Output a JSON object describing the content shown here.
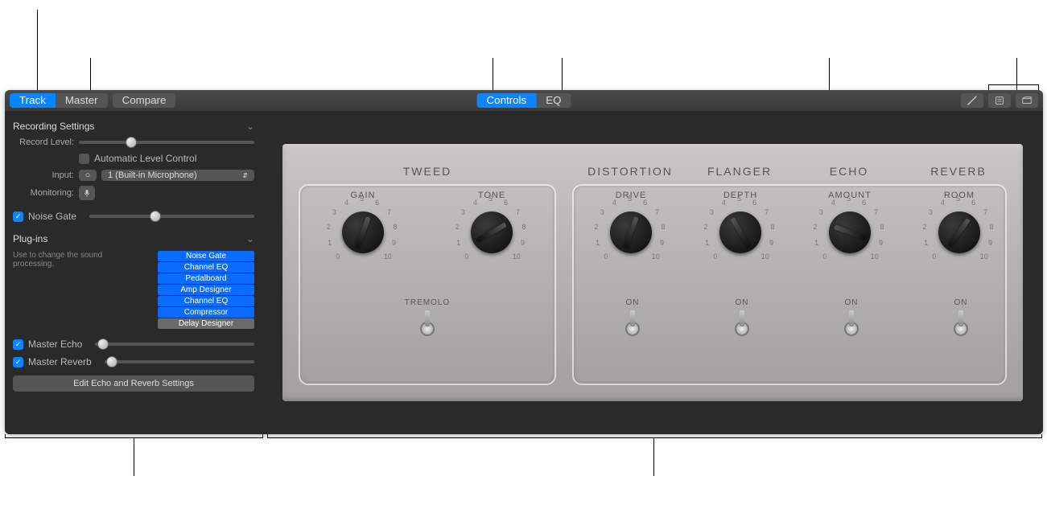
{
  "toolbar": {
    "track": "Track",
    "master": "Master",
    "compare": "Compare",
    "controls": "Controls",
    "eq": "EQ"
  },
  "sidebar": {
    "recording_settings": "Recording Settings",
    "record_level_label": "Record Level:",
    "auto_level": "Automatic Level Control",
    "input_label": "Input:",
    "input_symbol": "○",
    "input_value": "1  (Built-in Microphone)",
    "monitoring_label": "Monitoring:",
    "noise_gate": "Noise Gate",
    "plugins_header": "Plug-ins",
    "plugins_hint": "Use to change the sound processing.",
    "plugins": [
      {
        "label": "Noise Gate",
        "grey": false
      },
      {
        "label": "Channel EQ",
        "grey": false
      },
      {
        "label": "Pedalboard",
        "grey": false
      },
      {
        "label": "Amp Designer",
        "grey": false
      },
      {
        "label": "Channel EQ",
        "grey": false
      },
      {
        "label": "Compressor",
        "grey": false
      },
      {
        "label": "Delay Designer",
        "grey": true
      }
    ],
    "master_echo": "Master Echo",
    "master_reverb": "Master Reverb",
    "edit_btn": "Edit Echo and Reverb Settings"
  },
  "amp": {
    "tweed": "TWEED",
    "distortion": "DISTORTION",
    "flanger": "FLANGER",
    "echo": "ECHO",
    "reverb": "REVERB",
    "knobs": {
      "gain": "GAIN",
      "tone": "TONE",
      "drive": "DRIVE",
      "depth": "DEPTH",
      "amount": "AMOUNT",
      "room": "ROOM"
    },
    "tremolo": "TREMOLO",
    "on": "ON",
    "ticks": [
      "0",
      "1",
      "2",
      "3",
      "4",
      "5",
      "6",
      "7",
      "8",
      "9",
      "10"
    ]
  }
}
